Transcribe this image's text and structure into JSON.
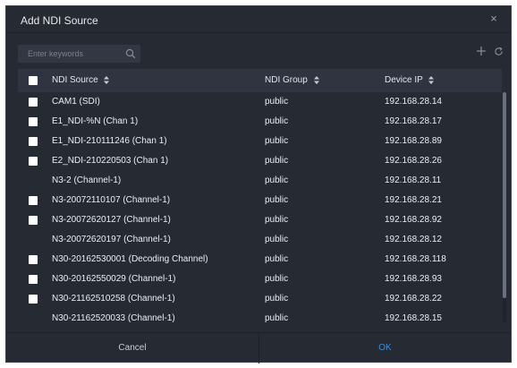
{
  "dialog": {
    "title": "Add NDI Source",
    "close_symbol": "×",
    "search_placeholder": "Enter keywords",
    "icons": [
      "search-icon",
      "add-icon",
      "refresh-icon",
      "close-icon",
      "sort-icon"
    ],
    "columns": {
      "source": "NDI Source",
      "group": "NDI Group",
      "ip": "Device IP"
    },
    "rows": [
      {
        "source": "CAM1 (SDI)",
        "group": "public",
        "ip": "192.168.28.14",
        "checkbox": true
      },
      {
        "source": "E1_NDI-%N (Chan 1)",
        "group": "public",
        "ip": "192.168.28.17",
        "checkbox": true
      },
      {
        "source": "E1_NDI-210111246 (Chan 1)",
        "group": "public",
        "ip": "192.168.28.89",
        "checkbox": true
      },
      {
        "source": "E2_NDI-210220503 (Chan 1)",
        "group": "public",
        "ip": "192.168.28.26",
        "checkbox": true
      },
      {
        "source": "N3-2 (Channel-1)",
        "group": "public",
        "ip": "192.168.28.11",
        "checkbox": false
      },
      {
        "source": "N3-20072110107 (Channel-1)",
        "group": "public",
        "ip": "192.168.28.21",
        "checkbox": true
      },
      {
        "source": "N3-20072620127 (Channel-1)",
        "group": "public",
        "ip": "192.168.28.92",
        "checkbox": true
      },
      {
        "source": "N3-20072620197 (Channel-1)",
        "group": "public",
        "ip": "192.168.28.12",
        "checkbox": false
      },
      {
        "source": "N30-20162530001 (Decoding Channel)",
        "group": "public",
        "ip": "192.168.28.118",
        "checkbox": true
      },
      {
        "source": "N30-20162550029 (Channel-1)",
        "group": "public",
        "ip": "192.168.28.93",
        "checkbox": true
      },
      {
        "source": "N30-21162510258 (Channel-1)",
        "group": "public",
        "ip": "192.168.28.22",
        "checkbox": true
      },
      {
        "source": "N30-21162520033 (Channel-1)",
        "group": "public",
        "ip": "192.168.28.15",
        "checkbox": false
      }
    ],
    "cancel_label": "Cancel",
    "ok_label": "OK",
    "colors": {
      "background": "#262a33",
      "header": "#2f3440",
      "accent": "#3f8fd8"
    }
  }
}
